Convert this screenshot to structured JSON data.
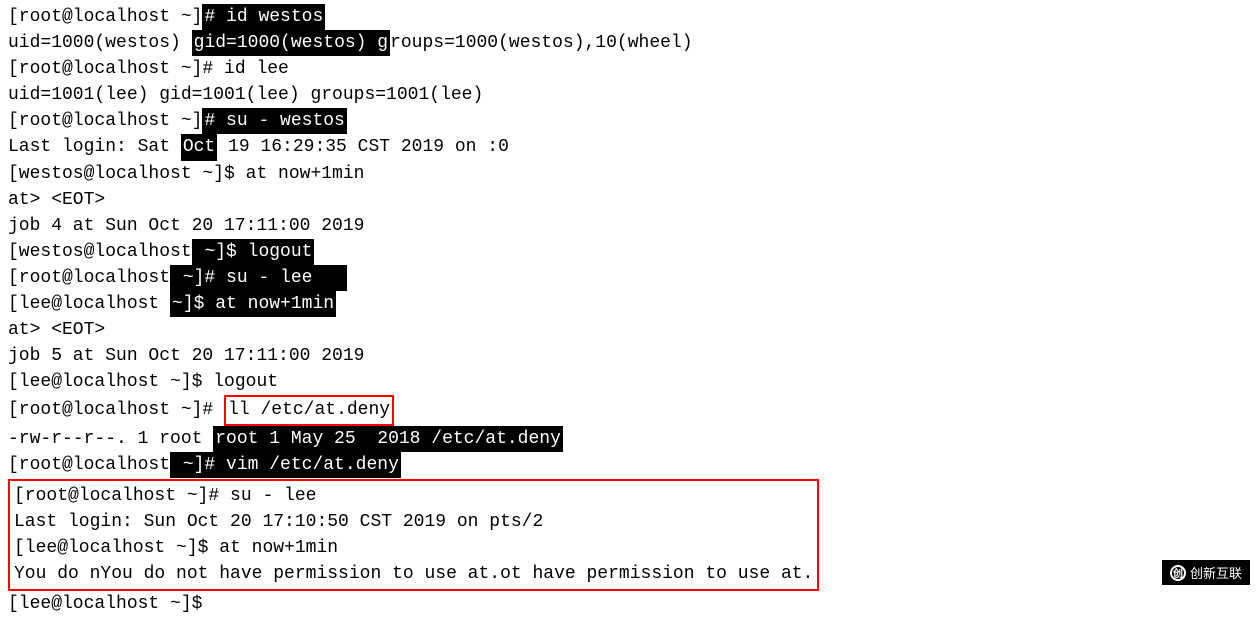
{
  "terminal": {
    "lines": [
      {
        "id": "l1",
        "text": "[root@localhost ~]# id westos",
        "highlight": "command",
        "highlight_start": 19,
        "highlight_end": 29
      },
      {
        "id": "l2",
        "text": "uid=1000(westos) gid=1000(westos) groups=1000(westos),10(wheel)"
      },
      {
        "id": "l3",
        "text": "[root@localhost ~]# id lee"
      },
      {
        "id": "l4",
        "text": "uid=1001(lee) gid=1001(lee) groups=1001(lee)"
      },
      {
        "id": "l5",
        "text": "[root@localhost ~]# su - westos",
        "highlight": "command",
        "highlight_start": 19,
        "highlight_end": 31
      },
      {
        "id": "l6",
        "text": "Last login: Sat Oct 19 16:29:35 CST 2019 on :0"
      },
      {
        "id": "l7",
        "text": "[westos@localhost ~]$ at now+1min"
      },
      {
        "id": "l8",
        "text": "at> <EOT>"
      },
      {
        "id": "l9",
        "text": "job 4 at Sun Oct 20 17:11:00 2019"
      },
      {
        "id": "l10",
        "text": "[westos@localhost ~]$ logout"
      },
      {
        "id": "l11",
        "text": "[root@localhost ~]# su - lee",
        "highlight": "command",
        "highlight_start": 19,
        "highlight_end": 28
      },
      {
        "id": "l12",
        "text": "[lee@localhost ~]$ at now+1min"
      },
      {
        "id": "l13",
        "text": "at> <EOT>"
      },
      {
        "id": "l14",
        "text": "job 5 at Sun Oct 20 17:11:00 2019"
      },
      {
        "id": "l15",
        "text": "[lee@localhost ~]$ logout"
      },
      {
        "id": "l16",
        "text": "[root@localhost ~]# ll /etc/at.deny",
        "highlight": "red-box",
        "highlight_start": 19,
        "highlight_end": 35
      },
      {
        "id": "l17",
        "text": "-rw-r--r--. 1 root root 1 May 25  2018 /etc/at.deny"
      },
      {
        "id": "l18",
        "text": "[root@localhost ~]# vim /etc/at.deny"
      },
      {
        "id": "l19",
        "text": "[root@localhost ~]# su - lee",
        "highlight": "red-box",
        "highlight_start": 0,
        "highlight_end": 999
      },
      {
        "id": "l20",
        "text": "Last login: Sun Oct 20 17:10:50 CST 2019 on pts/2",
        "highlight": "red-box",
        "highlight_start": 0,
        "highlight_end": 999
      },
      {
        "id": "l21",
        "text": "[lee@localhost ~]$ at now+1min",
        "highlight": "red-box",
        "highlight_start": 0,
        "highlight_end": 999
      },
      {
        "id": "l22",
        "text": "You do not have permission to use at.",
        "highlight": "red-box",
        "highlight_start": 0,
        "highlight_end": 999
      },
      {
        "id": "l23",
        "text": "[lee@localhost ~]$"
      }
    ]
  },
  "watermark": {
    "text": "创新互联"
  }
}
